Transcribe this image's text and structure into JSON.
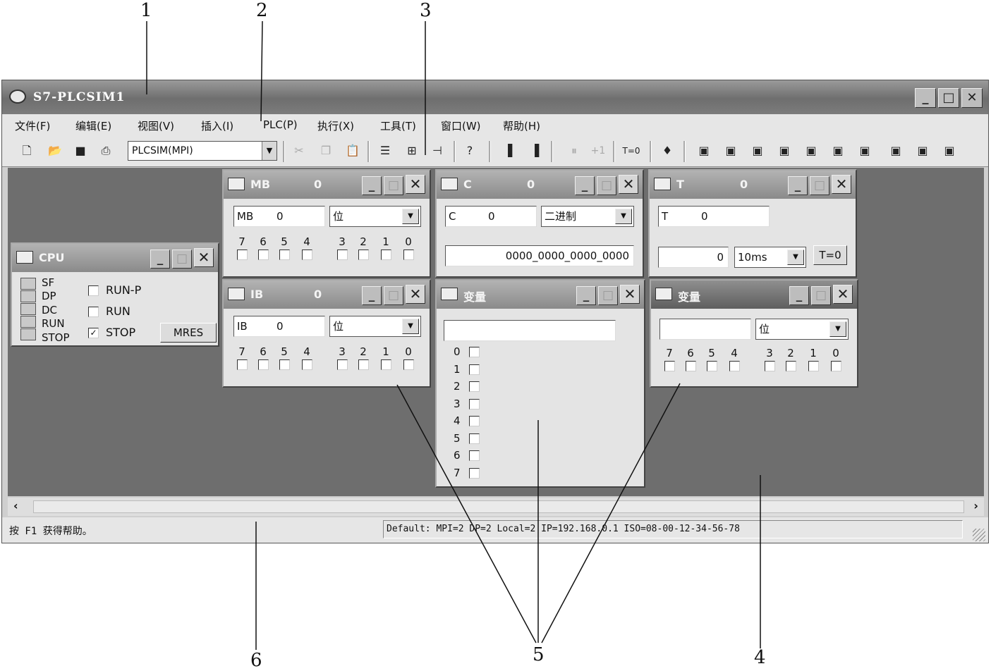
{
  "callouts": [
    "1",
    "2",
    "3",
    "4",
    "5",
    "6"
  ],
  "window": {
    "title": "S7-PLCSIM1",
    "minimize": "_",
    "maximize": "□",
    "close": "✕"
  },
  "menu": [
    "文件(F)",
    "编辑(E)",
    "视图(V)",
    "插入(I)",
    "PLC(P)",
    "执行(X)",
    "工具(T)",
    "窗口(W)",
    "帮助(H)"
  ],
  "toolbar": {
    "connection": "PLCSIM(MPI)",
    "step_label": "+1",
    "timer_reset": "T=0"
  },
  "mb": {
    "title": "MB",
    "title_value": "0",
    "address_label": "MB",
    "address_value": "0",
    "format": "位",
    "bit_labels": [
      "7",
      "6",
      "5",
      "4",
      "3",
      "2",
      "1",
      "0"
    ]
  },
  "c": {
    "title": "C",
    "title_value": "0",
    "address_label": "C",
    "address_value": "0",
    "format": "二进制",
    "value": "0000_0000_0000_0000"
  },
  "t": {
    "title": "T",
    "title_value": "0",
    "address_label": "T",
    "address_value": "0",
    "value": "0",
    "timebase": "10ms",
    "reset_button": "T=0"
  },
  "cpu": {
    "title": "CPU",
    "leds": [
      "SF",
      "DP",
      "DC",
      "RUN",
      "STOP"
    ],
    "modes": [
      {
        "label": "RUN-P",
        "checked": false
      },
      {
        "label": "RUN",
        "checked": false
      },
      {
        "label": "STOP",
        "checked": true
      }
    ],
    "mres_button": "MRES"
  },
  "ib": {
    "title": "IB",
    "title_value": "0",
    "address_label": "IB",
    "address_value": "0",
    "format": "位",
    "bit_labels": [
      "7",
      "6",
      "5",
      "4",
      "3",
      "2",
      "1",
      "0"
    ]
  },
  "var1": {
    "title": "变量",
    "address": "",
    "rows": [
      "0",
      "1",
      "2",
      "3",
      "4",
      "5",
      "6",
      "7"
    ]
  },
  "var2": {
    "title": "变量",
    "address": "",
    "format": "位",
    "bit_labels": [
      "7",
      "6",
      "5",
      "4",
      "3",
      "2",
      "1",
      "0"
    ]
  },
  "status": {
    "help": "按 F1 获得帮助。",
    "connection": "Default:  MPI=2 DP=2 Local=2 IP=192.168.0.1 ISO=08-00-12-34-56-78"
  }
}
